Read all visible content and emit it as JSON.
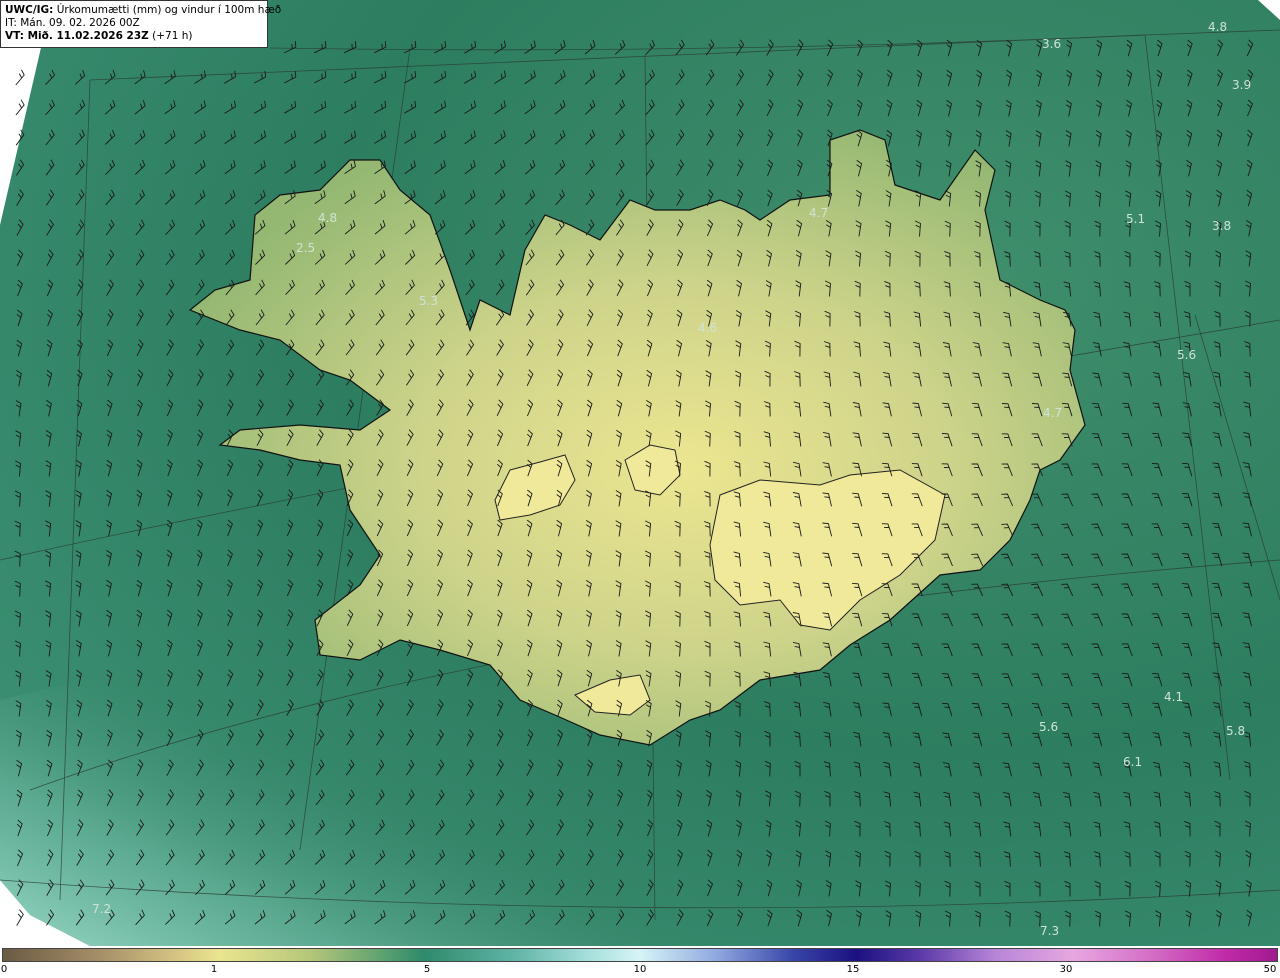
{
  "header": {
    "model": "UWC/IG:",
    "title": "Úrkomumætti (mm) og vindur í 100m hæð",
    "it_line": "IT: Mán. 09. 02. 2026 00Z",
    "vt_label": "VT: Mið. 11.02.2026 23Z",
    "vt_offset": "(+71 h)"
  },
  "colors": {
    "sea_dark": "#2a7a5e",
    "sea_light": "#8fd0c0",
    "land_low": "#8aae6a",
    "land_high": "#e9e38e",
    "coast": "#111111",
    "wind_barb": "#1a1a1a"
  },
  "map_labels": [
    {
      "text": "3.6"
    },
    {
      "text": "4.8"
    },
    {
      "text": "3.9"
    },
    {
      "text": "4.7"
    },
    {
      "text": "4.8"
    },
    {
      "text": "2.5"
    },
    {
      "text": "5.3"
    },
    {
      "text": "5.1"
    },
    {
      "text": "3.8"
    },
    {
      "text": "4.6"
    },
    {
      "text": "5.6"
    },
    {
      "text": "4.7"
    },
    {
      "text": "4.1"
    },
    {
      "text": "5.6"
    },
    {
      "text": "5.8"
    },
    {
      "text": "6.1"
    },
    {
      "text": "7.2"
    },
    {
      "text": "7.3"
    }
  ],
  "colorbar": {
    "ticks": [
      {
        "value": 0,
        "label": "0"
      },
      {
        "value": 1,
        "label": "1"
      },
      {
        "value": 5,
        "label": "5"
      },
      {
        "value": 10,
        "label": "10"
      },
      {
        "value": 15,
        "label": "15"
      },
      {
        "value": 30,
        "label": "30"
      },
      {
        "value": 50,
        "label": "50"
      }
    ]
  }
}
